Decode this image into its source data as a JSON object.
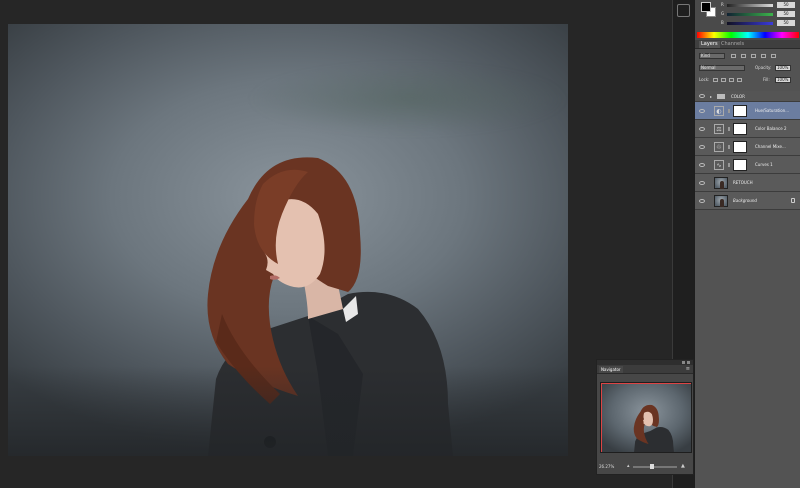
{
  "color_panel": {
    "slider_labels": [
      "R",
      "G",
      "B"
    ],
    "slider_values": [
      "50",
      "50",
      "50"
    ],
    "slider_colors": [
      "#c8c8c8",
      "#3cb44b",
      "#3a3adc"
    ]
  },
  "layers_panel": {
    "tabs": [
      "Layers",
      "Channels"
    ],
    "filter_label": "Kind",
    "blend_mode": "Normal",
    "opacity_label": "Opacity:",
    "opacity_value": "100%",
    "lock_label": "Lock:",
    "fill_label": "Fill:",
    "fill_value": "100%",
    "group": {
      "name": "COLOR"
    },
    "layers": [
      {
        "name": "Hue/Saturation...",
        "icon": "hue-saturation-icon",
        "selected": true
      },
      {
        "name": "Color Balance 2",
        "icon": "color-balance-icon",
        "selected": false
      },
      {
        "name": "Channel Mixe...",
        "icon": "channel-mixer-icon",
        "selected": false
      },
      {
        "name": "Curves 1",
        "icon": "curves-icon",
        "selected": false
      }
    ],
    "pixel_layers": [
      {
        "name": "RETOUCH"
      },
      {
        "name": "Background"
      }
    ]
  },
  "navigator": {
    "tab_label": "Navigator",
    "zoom_value": "26.27%",
    "zoom_slider_fraction": 0.42
  },
  "colors": {
    "selected_layer": "#6b7da0",
    "view_box": "#dd4444"
  }
}
